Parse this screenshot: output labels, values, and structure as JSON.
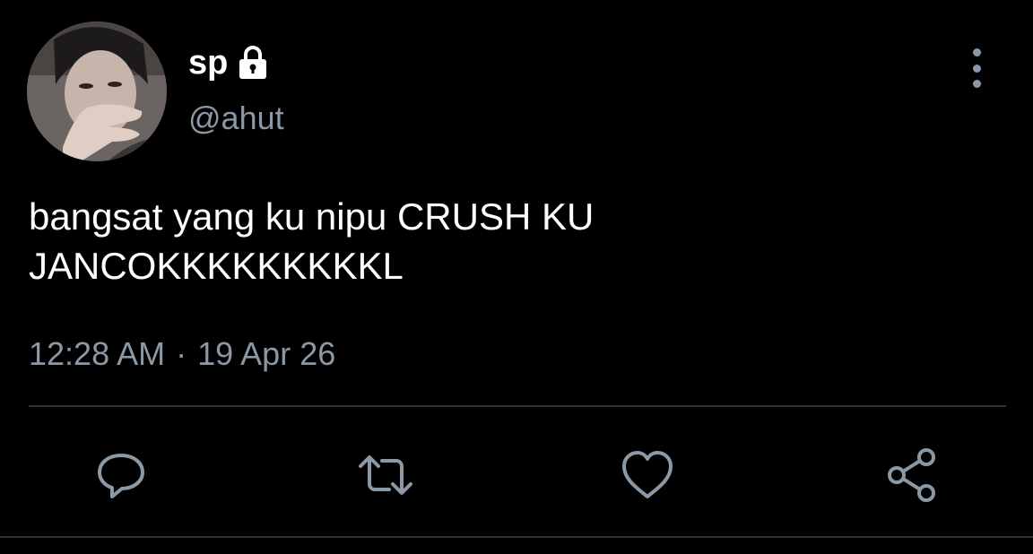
{
  "user": {
    "display_name": "sp",
    "handle": "@ahut",
    "protected_icon": "lock-icon",
    "avatar_icon": "profile-photo"
  },
  "tweet": {
    "text": "bangsat yang ku nipu CRUSH KU\nJANCOKKKKKKKKKL",
    "time": "12:28 AM",
    "separator": "·",
    "date": "19 Apr 26"
  },
  "actions": [
    {
      "icon": "reply-icon"
    },
    {
      "icon": "retweet-icon"
    },
    {
      "icon": "like-icon"
    },
    {
      "icon": "share-icon"
    }
  ],
  "menu_icon": "more-options-icon",
  "colors": {
    "background": "#000000",
    "primary_text": "#ffffff",
    "secondary_text": "#8b98a5",
    "divider": "#2f3336"
  }
}
